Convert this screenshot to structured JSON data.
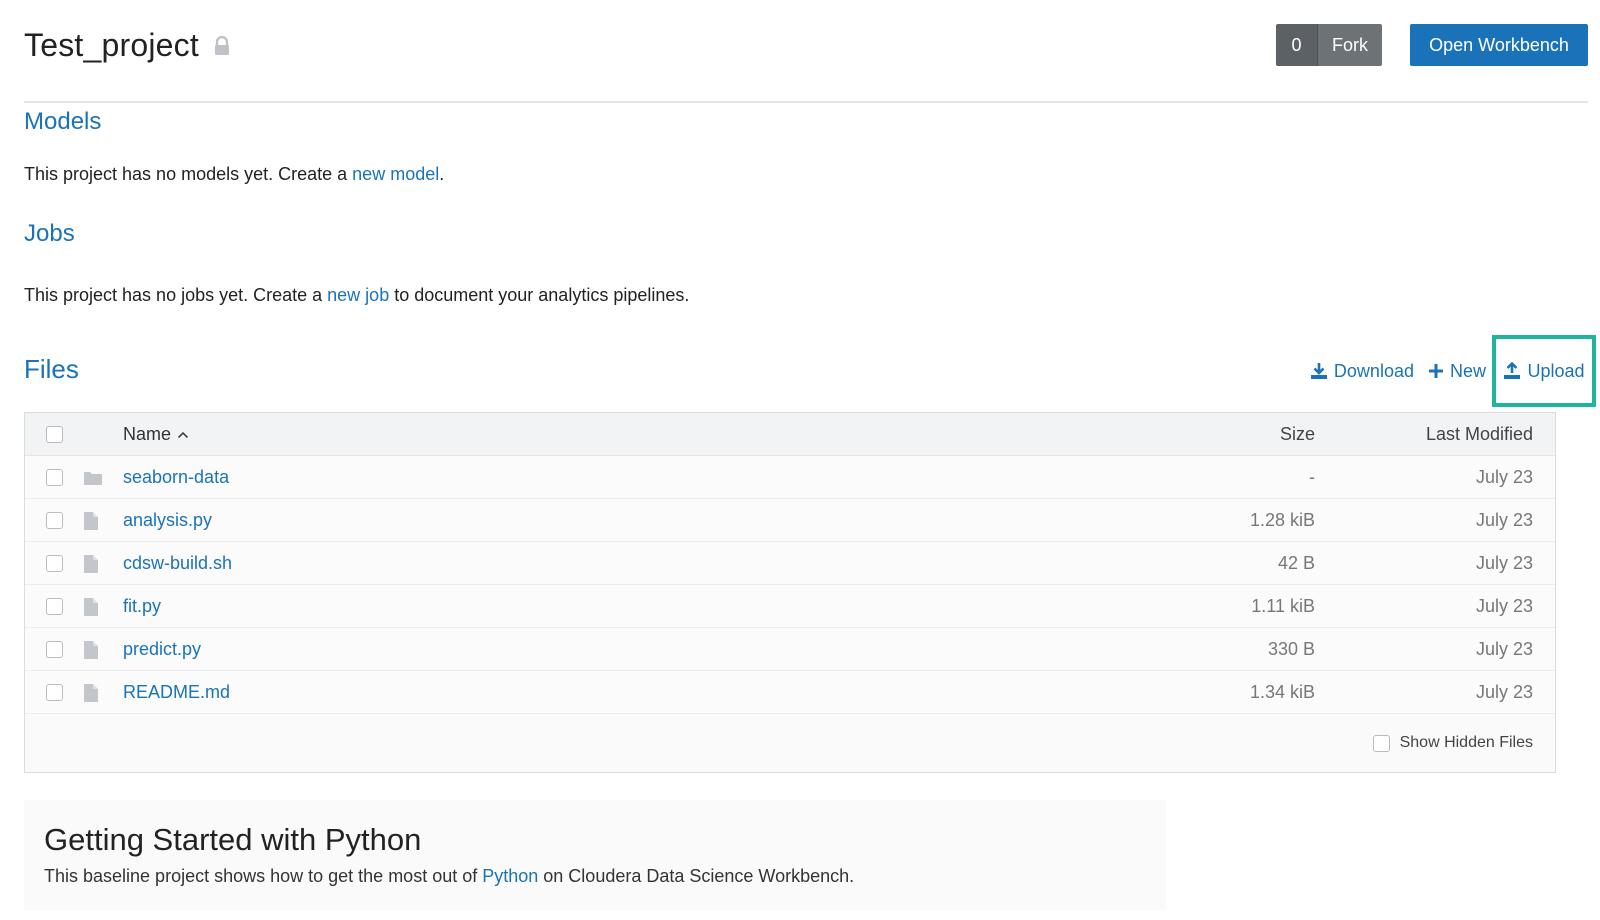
{
  "header": {
    "title": "Test_project",
    "fork_count": "0",
    "fork_label": "Fork",
    "open_workbench_label": "Open Workbench"
  },
  "models": {
    "title": "Models",
    "text_before": "This project has no models yet. Create a ",
    "link": "new model",
    "text_after": "."
  },
  "jobs": {
    "title": "Jobs",
    "text_before": "This project has no jobs yet. Create a ",
    "link": "new job",
    "text_after": " to document your analytics pipelines."
  },
  "files": {
    "title": "Files",
    "actions": {
      "download": "Download",
      "new": "New",
      "upload": "Upload"
    },
    "columns": {
      "name": "Name",
      "size": "Size",
      "last_modified": "Last Modified"
    },
    "rows": [
      {
        "name": "seaborn-data",
        "type": "folder",
        "size": "-",
        "modified": "July 23"
      },
      {
        "name": "analysis.py",
        "type": "file",
        "size": "1.28 kiB",
        "modified": "July 23"
      },
      {
        "name": "cdsw-build.sh",
        "type": "file",
        "size": "42 B",
        "modified": "July 23"
      },
      {
        "name": "fit.py",
        "type": "file",
        "size": "1.11 kiB",
        "modified": "July 23"
      },
      {
        "name": "predict.py",
        "type": "file",
        "size": "330 B",
        "modified": "July 23"
      },
      {
        "name": "README.md",
        "type": "file",
        "size": "1.34 kiB",
        "modified": "July 23"
      }
    ],
    "show_hidden_label": "Show Hidden Files"
  },
  "getting_started": {
    "title": "Getting Started with Python",
    "text_before": "This baseline project shows how to get the most out of ",
    "link": "Python",
    "text_after": " on Cloudera Data Science Workbench."
  },
  "colors": {
    "accent": "#1a73b8",
    "highlight": "#1fb59b",
    "fork_bg": "#6d7277"
  }
}
